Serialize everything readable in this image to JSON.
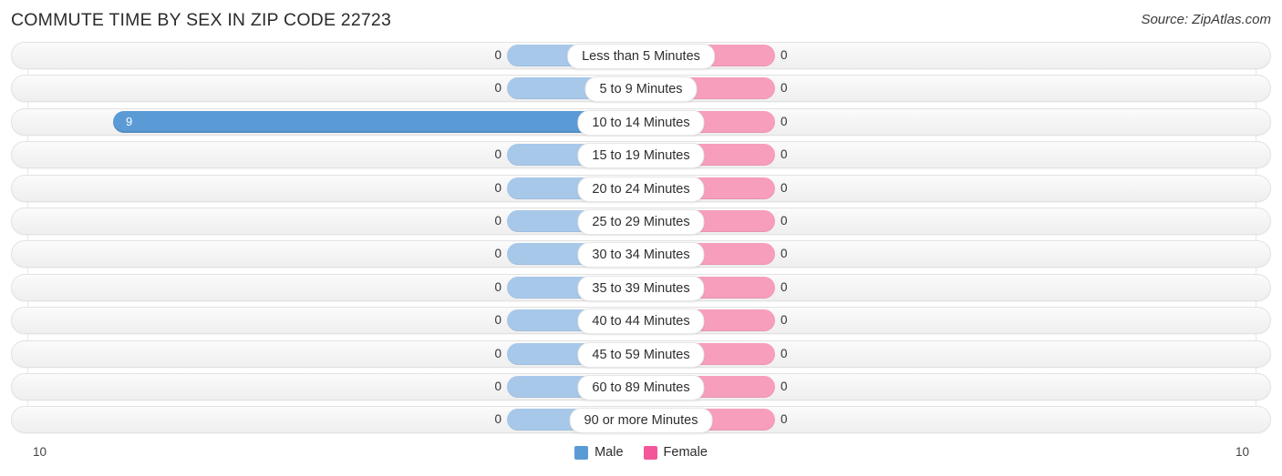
{
  "header": {
    "title": "COMMUTE TIME BY SEX IN ZIP CODE 22723",
    "source": "Source: ZipAtlas.com"
  },
  "legend": {
    "male_label": "Male",
    "female_label": "Female",
    "male_color": "#5b9bd5",
    "female_color": "#f4569b"
  },
  "axis": {
    "left_label": "10",
    "right_label": "10"
  },
  "chart_data": {
    "type": "bar",
    "title": "COMMUTE TIME BY SEX IN ZIP CODE 22723",
    "subtitle": "Source: ZipAtlas.com",
    "orientation": "horizontal-diverging",
    "xlabel": "",
    "ylabel": "",
    "xlim": [
      10,
      10
    ],
    "grid": true,
    "legend_position": "bottom-center",
    "categories": [
      "Less than 5 Minutes",
      "5 to 9 Minutes",
      "10 to 14 Minutes",
      "15 to 19 Minutes",
      "20 to 24 Minutes",
      "25 to 29 Minutes",
      "30 to 34 Minutes",
      "35 to 39 Minutes",
      "40 to 44 Minutes",
      "45 to 59 Minutes",
      "60 to 89 Minutes",
      "90 or more Minutes"
    ],
    "series": [
      {
        "name": "Male",
        "color": "#5b9bd5",
        "values": [
          0,
          0,
          9,
          0,
          0,
          0,
          0,
          0,
          0,
          0,
          0,
          0
        ]
      },
      {
        "name": "Female",
        "color": "#f4569b",
        "values": [
          0,
          0,
          0,
          0,
          0,
          0,
          0,
          0,
          0,
          0,
          0,
          0
        ]
      }
    ],
    "rows": [
      {
        "label": "Less than 5 Minutes",
        "male": "0",
        "female": "0",
        "male_pct": 0,
        "female_pct": 0,
        "highlight": false
      },
      {
        "label": "5 to 9 Minutes",
        "male": "0",
        "female": "0",
        "male_pct": 0,
        "female_pct": 0,
        "highlight": false
      },
      {
        "label": "10 to 14 Minutes",
        "male": "9",
        "female": "0",
        "male_pct": 90,
        "female_pct": 0,
        "highlight": true
      },
      {
        "label": "15 to 19 Minutes",
        "male": "0",
        "female": "0",
        "male_pct": 0,
        "female_pct": 0,
        "highlight": false
      },
      {
        "label": "20 to 24 Minutes",
        "male": "0",
        "female": "0",
        "male_pct": 0,
        "female_pct": 0,
        "highlight": false
      },
      {
        "label": "25 to 29 Minutes",
        "male": "0",
        "female": "0",
        "male_pct": 0,
        "female_pct": 0,
        "highlight": false
      },
      {
        "label": "30 to 34 Minutes",
        "male": "0",
        "female": "0",
        "male_pct": 0,
        "female_pct": 0,
        "highlight": false
      },
      {
        "label": "35 to 39 Minutes",
        "male": "0",
        "female": "0",
        "male_pct": 0,
        "female_pct": 0,
        "highlight": false
      },
      {
        "label": "40 to 44 Minutes",
        "male": "0",
        "female": "0",
        "male_pct": 0,
        "female_pct": 0,
        "highlight": false
      },
      {
        "label": "45 to 59 Minutes",
        "male": "0",
        "female": "0",
        "male_pct": 0,
        "female_pct": 0,
        "highlight": false
      },
      {
        "label": "60 to 89 Minutes",
        "male": "0",
        "female": "0",
        "male_pct": 0,
        "female_pct": 0,
        "highlight": false
      },
      {
        "label": "90 or more Minutes",
        "male": "0",
        "female": "0",
        "male_pct": 0,
        "female_pct": 0,
        "highlight": false
      }
    ]
  }
}
